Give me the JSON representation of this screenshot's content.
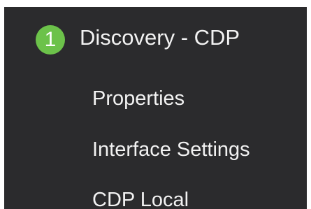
{
  "section": {
    "step_number": "1",
    "title": "Discovery - CDP",
    "badge_color": "#6cc24a"
  },
  "menu": {
    "items": [
      {
        "label": "Properties"
      },
      {
        "label": "Interface Settings"
      },
      {
        "label": "CDP Local"
      }
    ]
  },
  "colors": {
    "panel_background": "#2b2b2d",
    "text": "#f2f2f2"
  }
}
